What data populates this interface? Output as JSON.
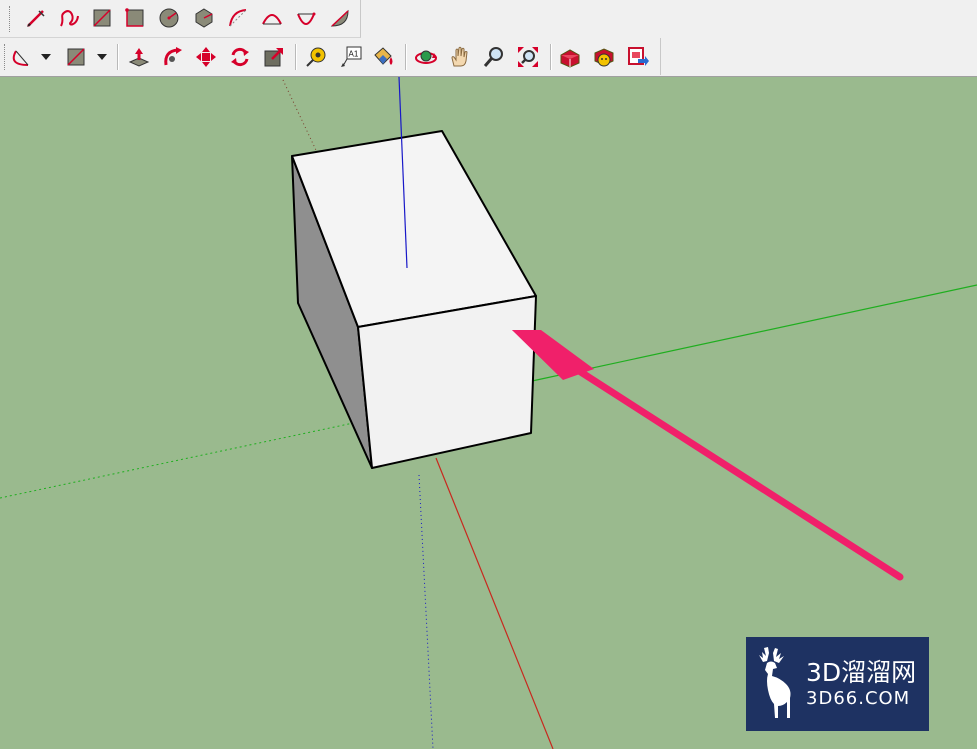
{
  "toolbar_row1": {
    "tools": [
      {
        "name": "line-tool",
        "icon": "pencil-icon"
      },
      {
        "name": "freehand-tool",
        "icon": "freehand-icon"
      },
      {
        "name": "rectangle-tool",
        "icon": "rectangle-icon"
      },
      {
        "name": "rotated-rectangle-tool",
        "icon": "rotated-rectangle-icon"
      },
      {
        "name": "circle-tool",
        "icon": "circle-icon"
      },
      {
        "name": "polygon-tool",
        "icon": "polygon-icon"
      },
      {
        "name": "arc-tool",
        "icon": "arc-icon"
      },
      {
        "name": "two-point-arc-tool",
        "icon": "two-point-arc-icon"
      },
      {
        "name": "three-point-arc-tool",
        "icon": "three-point-arc-icon"
      },
      {
        "name": "pie-tool",
        "icon": "pie-icon"
      }
    ]
  },
  "toolbar_row2": {
    "tools": [
      {
        "name": "arc-dropdown",
        "icon": "arc-icon"
      },
      {
        "name": "shapes-dropdown",
        "icon": "rectangle-icon"
      },
      {
        "name": "push-pull-tool",
        "icon": "push-pull-icon"
      },
      {
        "name": "follow-me-tool",
        "icon": "follow-me-icon"
      },
      {
        "name": "move-tool",
        "icon": "move-icon"
      },
      {
        "name": "rotate-tool",
        "icon": "rotate-icon"
      },
      {
        "name": "scale-tool",
        "icon": "scale-icon"
      },
      {
        "name": "tape-measure-tool",
        "icon": "tape-measure-icon"
      },
      {
        "name": "text-tool",
        "icon": "text-label-icon",
        "label": "A1"
      },
      {
        "name": "paint-bucket-tool",
        "icon": "paint-bucket-icon"
      },
      {
        "name": "orbit-tool",
        "icon": "orbit-icon"
      },
      {
        "name": "pan-tool",
        "icon": "hand-icon"
      },
      {
        "name": "zoom-tool",
        "icon": "magnifier-icon"
      },
      {
        "name": "zoom-extents-tool",
        "icon": "zoom-extents-icon"
      },
      {
        "name": "3d-warehouse-button",
        "icon": "warehouse-icon"
      },
      {
        "name": "extension-warehouse-button",
        "icon": "extension-icon"
      },
      {
        "name": "share-model-button",
        "icon": "share-icon"
      }
    ]
  },
  "colors": {
    "accent_red": "#d6002a",
    "viewport_bg": "#9aba8e",
    "box_face": "#f2f2f2",
    "box_side": "#8f8f8f",
    "axis_red": "#c8281e",
    "axis_green": "#1fae1f",
    "axis_blue": "#1818c8",
    "annotation_arrow": "#f0206a",
    "watermark_bg": "#1e3262"
  },
  "watermark": {
    "title": "3D溜溜网",
    "subtitle": "3D66.COM",
    "icon": "deer-logo-icon"
  }
}
